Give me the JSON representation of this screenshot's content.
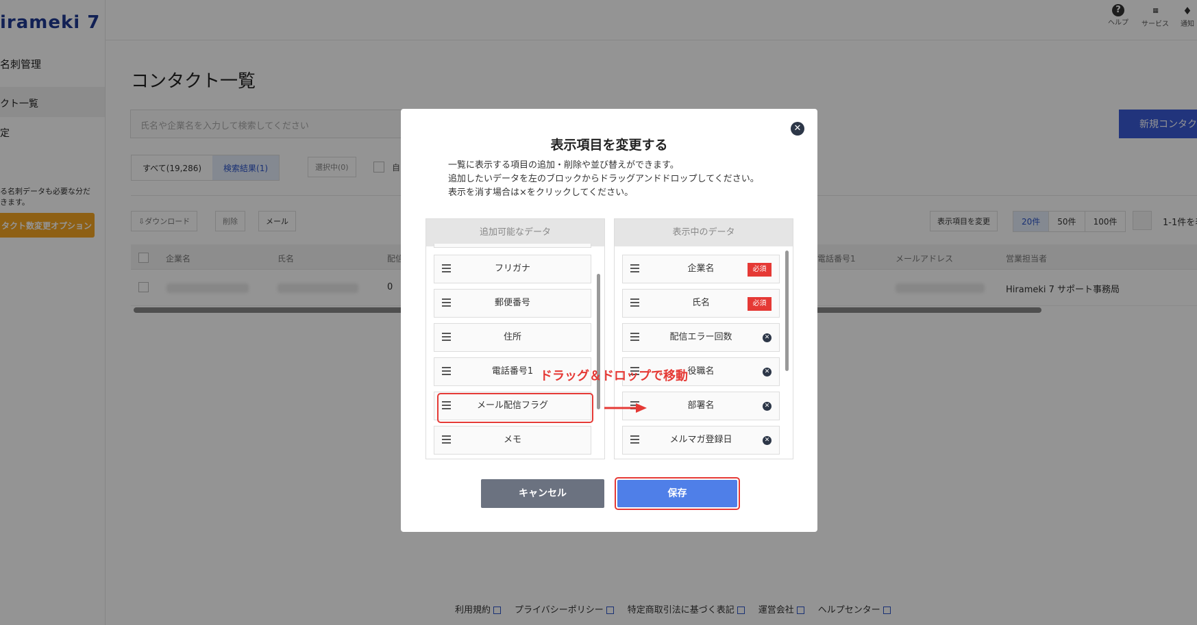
{
  "app": {
    "brand": "irameki 7",
    "sidebar": {
      "section": "名刺管理",
      "items": [
        "クト一覧",
        "定"
      ],
      "note_lines": [
        "る名刺データも必要な分だ",
        "きます。"
      ],
      "option_button": "タクト数変更オプション"
    },
    "topnav": [
      {
        "icon": "help-icon",
        "glyph": "?",
        "label": "ヘルプ"
      },
      {
        "icon": "grid-icon",
        "glyph": "⋮⋮⋮",
        "label": "サービス"
      },
      {
        "icon": "bell-icon",
        "glyph": "🔔",
        "label": "通知"
      }
    ]
  },
  "page": {
    "title": "コンタクト一覧",
    "search_placeholder": "氏名や企業名を入力して検索してください",
    "new_button": "新規コンタク",
    "tabs": [
      {
        "label": "すべて(19,286)"
      },
      {
        "label": "検索結果(1)"
      }
    ],
    "selected_label": "選択中(0)",
    "auto_label": "自",
    "toolbar": {
      "download": "ダウンロード",
      "delete": "削除",
      "mail": "メール"
    },
    "change_columns": "表示項目を変更",
    "page_sizes": [
      "20件",
      "50件",
      "100件"
    ],
    "range": "1-1件を表",
    "columns": [
      "企業名",
      "氏名",
      "配信",
      "電話番号1",
      "メールアドレス",
      "営業担当者"
    ],
    "row": {
      "delivery_errors": "0",
      "owner": "Hirameki 7 サポート事務局"
    }
  },
  "modal": {
    "title": "表示項目を変更する",
    "desc": [
      "一覧に表示する項目の追加・削除や並び替えができます。",
      "追加したいデータを左のブロックからドラッグアンドドロップしてください。",
      "表示を消す場合は×をクリックしてください。"
    ],
    "available_header": "追加可能なデータ",
    "available": [
      "フリガナ",
      "郵便番号",
      "住所",
      "電話番号1",
      "メール配信フラグ",
      "メモ"
    ],
    "displayed_header": "表示中のデータ",
    "displayed": [
      {
        "label": "企業名",
        "required": true
      },
      {
        "label": "氏名",
        "required": true
      },
      {
        "label": "配信エラー回数",
        "required": false
      },
      {
        "label": "役職名",
        "required": false
      },
      {
        "label": "部署名",
        "required": false
      },
      {
        "label": "メルマガ登録日",
        "required": false
      }
    ],
    "required_badge": "必須",
    "annotation": "ドラッグ＆ドロップで移動",
    "cancel": "キャンセル",
    "save": "保存"
  },
  "footer": [
    "利用規約",
    "プライバシーポリシー",
    "特定商取引法に基づく表記",
    "運営会社",
    "ヘルプセンター"
  ],
  "colors": {
    "accent": "#4f7fe8",
    "highlight": "#e53935",
    "brand": "#1f3a93"
  }
}
